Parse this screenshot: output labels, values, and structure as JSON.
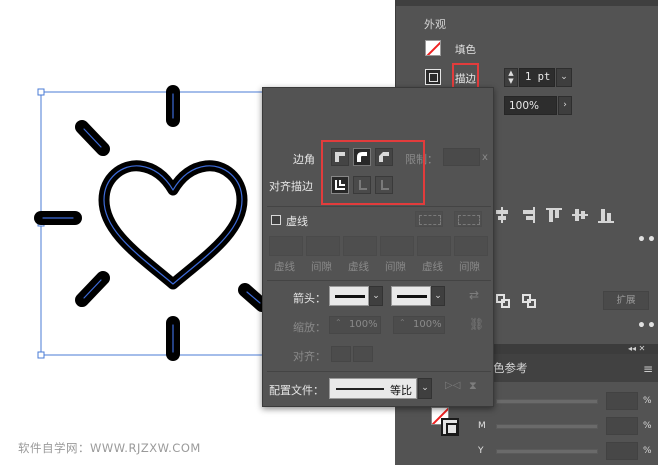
{
  "watermark": "软件自学网：WWW.RJZXW.COM",
  "properties": {
    "section_title": "外观",
    "fill_label": "填色",
    "stroke_label": "描边",
    "stroke_weight": "1 pt",
    "opacity": "100%",
    "expand_label": "扩展"
  },
  "stroke_popup": {
    "corner_label": "边角",
    "limit_label": "限制：",
    "limit_unit": "x",
    "align_label": "对齐描边",
    "dashed_label": "虚线",
    "dash_captions": [
      "虚线",
      "间隙",
      "虚线",
      "间隙",
      "虚线",
      "间隙"
    ],
    "arrow_label": "箭头：",
    "scale_label": "缩放：",
    "scale_start": "100%",
    "scale_end": "100%",
    "align_arrow_label": "对齐：",
    "profile_label": "配置文件：",
    "profile_value": "等比"
  },
  "color_panel": {
    "tab_label": "色参考",
    "channel_labels": [
      "M",
      "Y"
    ],
    "pct_sign": "%"
  },
  "colors": {
    "panel_bg": "#535353",
    "highlight_red": "#e23c3c",
    "selection_blue": "#3d6bd9"
  },
  "icons": [
    "heart-sun-artwork",
    "fill-swatch-icon",
    "stroke-swatch-icon",
    "corner-join-icon",
    "align-stroke-icon",
    "swap-arrow-icon",
    "link-icon",
    "menu-icon"
  ]
}
